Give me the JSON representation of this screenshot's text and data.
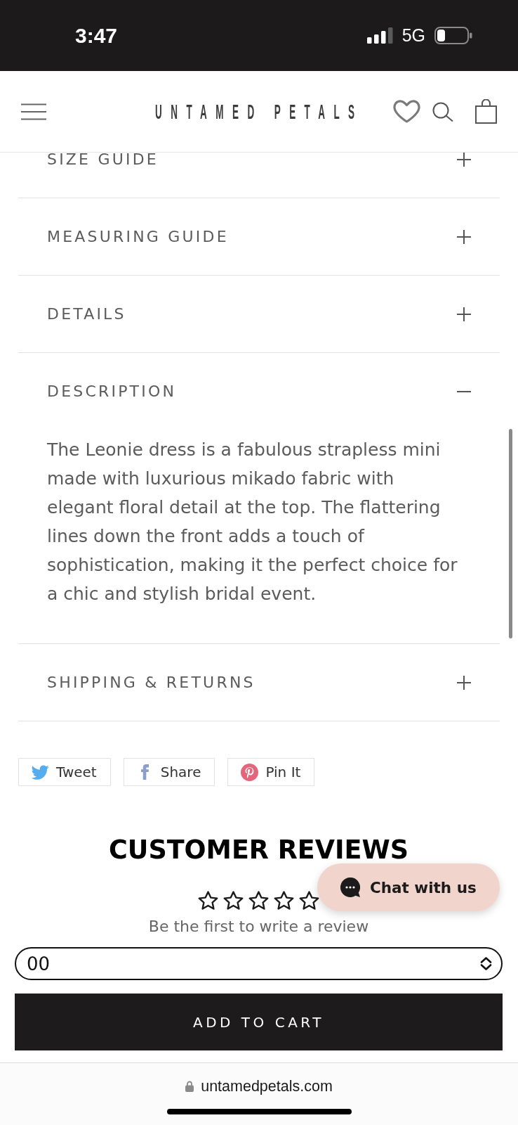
{
  "status_bar": {
    "time": "3:47",
    "network": "5G"
  },
  "header": {
    "logo": "UNTAMED PETALS"
  },
  "accordion": [
    {
      "title": "SIZE GUIDE",
      "expanded": false
    },
    {
      "title": "MEASURING GUIDE",
      "expanded": false
    },
    {
      "title": "DETAILS",
      "expanded": false
    },
    {
      "title": "DESCRIPTION",
      "expanded": true,
      "content": "The Leonie dress is a fabulous strapless mini made with luxurious mikado fabric with elegant floral detail at the top. The flattering lines down the front adds a touch of sophistication, making it the perfect choice for a chic and stylish bridal event."
    },
    {
      "title": "SHIPPING & RETURNS",
      "expanded": false
    }
  ],
  "share_buttons": [
    {
      "kind": "twitter",
      "label": "Tweet"
    },
    {
      "kind": "facebook",
      "label": "Share"
    },
    {
      "kind": "pinterest",
      "label": "Pin It"
    }
  ],
  "reviews": {
    "title": "CUSTOMER REVIEWS",
    "stars": 0,
    "prompt": "Be the first to write a review"
  },
  "chat_button": {
    "label": "Chat with us"
  },
  "size_select": {
    "value": "00"
  },
  "add_to_cart": {
    "label": "ADD TO CART"
  },
  "browser": {
    "url": "untamedpetals.com"
  }
}
